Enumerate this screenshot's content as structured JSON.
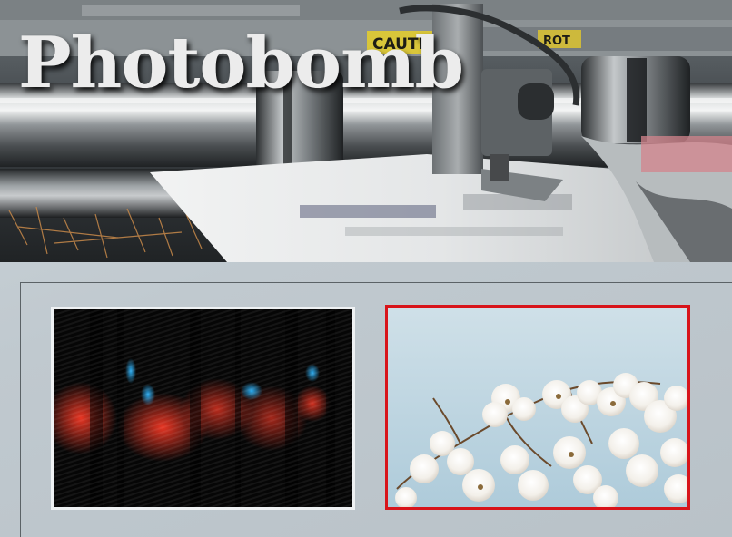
{
  "header": {
    "title": "Photobomb",
    "hero_image": "printing-press-photo",
    "hero_caution_text": "CAUTIO",
    "hero_rot_text": "ROT"
  },
  "gallery": {
    "items": [
      {
        "image": "dark-abstract-lights-photo",
        "selected": false
      },
      {
        "image": "white-magnolia-blossoms-photo",
        "selected": true
      }
    ],
    "colors": {
      "selected_border": "#d8141a",
      "default_border": "#eef1f3"
    }
  }
}
